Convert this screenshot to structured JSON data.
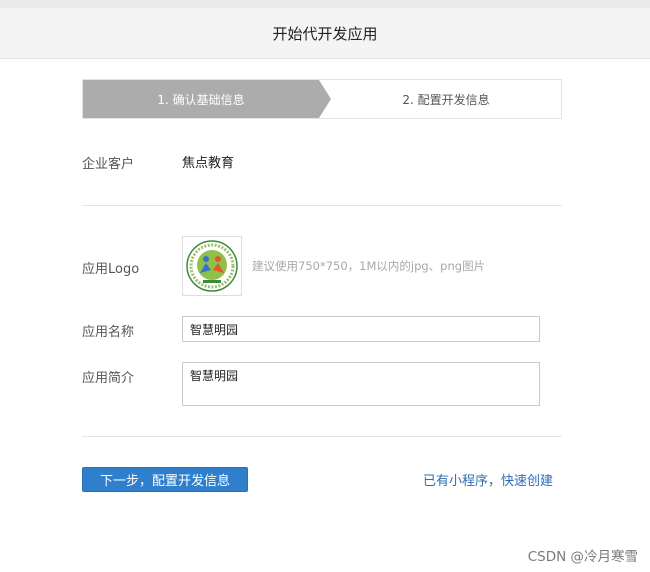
{
  "header": {
    "title": "开始代开发应用"
  },
  "steps": {
    "step1": "1. 确认基础信息",
    "step2": "2. 配置开发信息"
  },
  "form": {
    "enterprise_label": "企业客户",
    "enterprise_value": "焦点教育",
    "logo_label": "应用Logo",
    "logo_hint": "建议使用750*750，1M以内的jpg、png图片",
    "name_label": "应用名称",
    "name_value": "智慧明园",
    "intro_label": "应用简介",
    "intro_value": "智慧明园"
  },
  "actions": {
    "next_label": "下一步，配置开发信息",
    "quick_link": "已有小程序，快速创建"
  },
  "watermark": "CSDN @冷月寒雪",
  "colors": {
    "accent": "#2f7fcc",
    "step_active": "#acacac",
    "link": "#2f6db3"
  }
}
